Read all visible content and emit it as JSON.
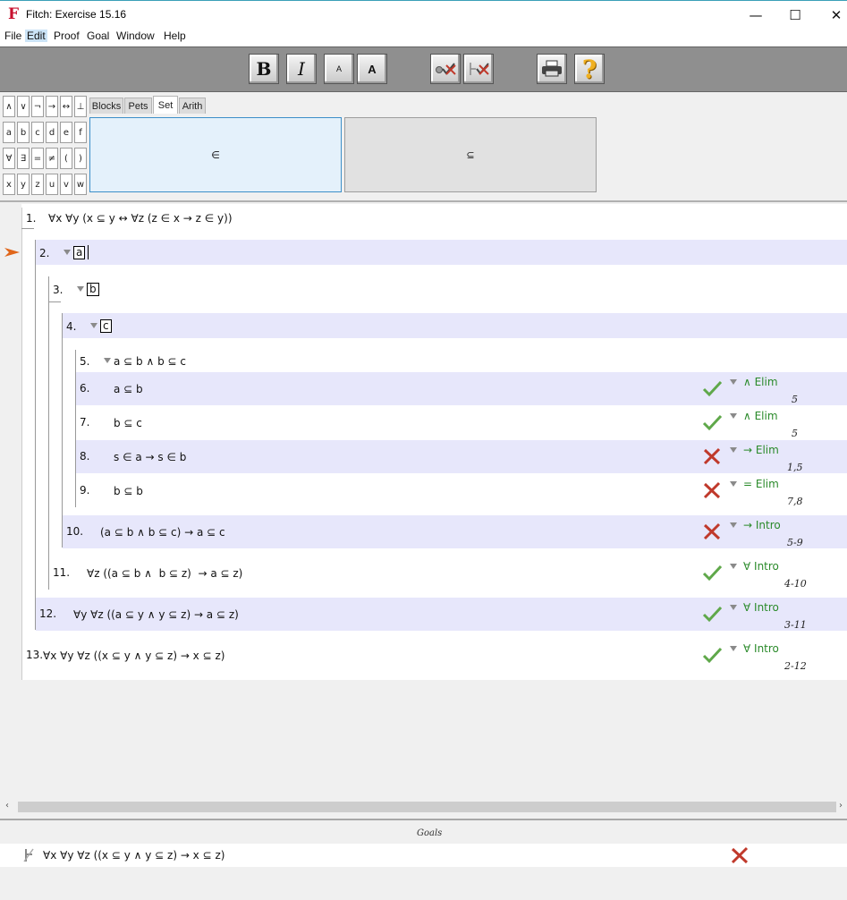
{
  "window": {
    "title": "Fitch: Exercise 15.16",
    "app_icon": "fitch-logo",
    "controls": {
      "minimize": "—",
      "maximize": "☐",
      "close": "✕"
    }
  },
  "menu": [
    "File",
    "Edit",
    "Proof",
    "Goal",
    "Window",
    "Help"
  ],
  "toolbar": {
    "bold": "B",
    "italic": "I",
    "font_small": "A",
    "font_large": "A"
  },
  "palette": {
    "rows": [
      [
        "∧",
        "∨",
        "¬",
        "→",
        "↔",
        "⊥"
      ],
      [
        "a",
        "b",
        "c",
        "d",
        "e",
        "f"
      ],
      [
        "∀",
        "∃",
        "=",
        "≠",
        "(",
        ")"
      ],
      [
        "x",
        "y",
        "z",
        "u",
        "v",
        "w"
      ]
    ]
  },
  "tabs": [
    "Blocks",
    "Pets",
    "Set",
    "Arith"
  ],
  "selected_tab": "Set",
  "set_panels": [
    "∈",
    "⊆"
  ],
  "proof": {
    "steps": [
      {
        "num": "1.",
        "sentence": "∀x ∀y (x ⊆ y ↔ ∀z (z ∈ x → z ∈ y))"
      },
      {
        "num": "2.",
        "boxed": "a"
      },
      {
        "num": "3.",
        "boxed": "b"
      },
      {
        "num": "4.",
        "boxed": "c"
      },
      {
        "num": "5.",
        "sentence": "a ⊆ b ∧ b ⊆ c"
      },
      {
        "num": "6.",
        "sentence": "a ⊆ b",
        "rule": "∧ Elim",
        "support": "5",
        "status": "ok"
      },
      {
        "num": "7.",
        "sentence": "b ⊆ c",
        "rule": "∧ Elim",
        "support": "5",
        "status": "ok"
      },
      {
        "num": "8.",
        "sentence": "s ∈ a → s ∈ b",
        "rule": "→ Elim",
        "support": "1,5",
        "status": "fail"
      },
      {
        "num": "9.",
        "sentence": "b ⊆ b",
        "rule": "= Elim",
        "support": "7,8",
        "status": "fail"
      },
      {
        "num": "10.",
        "sentence": "(a ⊆ b ∧ b ⊆ c) → a ⊆ c",
        "rule": "→ Intro",
        "support": "5-9",
        "status": "fail"
      },
      {
        "num": "11.",
        "sentence": "∀z ((a ⊆ b ∧  b ⊆ z)  → a ⊆ z)",
        "rule": "∀ Intro",
        "support": "4-10",
        "status": "ok"
      },
      {
        "num": "12.",
        "sentence": "∀y ∀z ((a ⊆ y ∧ y ⊆ z) → a ⊆ z)",
        "rule": "∀ Intro",
        "support": "3-11",
        "status": "ok"
      },
      {
        "num": "13.",
        "sentence": "∀x ∀y ∀z ((x ⊆ y ∧ y ⊆ z) → x ⊆ z)",
        "rule": "∀ Intro",
        "support": "2-12",
        "status": "ok"
      }
    ]
  },
  "goals": {
    "title": "Goals",
    "items": [
      {
        "sentence": "∀x ∀y ∀z ((x ⊆ y ∧ y ⊆ z) → x ⊆ z)",
        "status": "fail"
      }
    ]
  },
  "colors": {
    "ok": "#5fa84a",
    "fail": "#c0392b",
    "rule": "#2a8a2a",
    "shade": "#e7e7fb",
    "focus_arrow": "#e0661a"
  }
}
